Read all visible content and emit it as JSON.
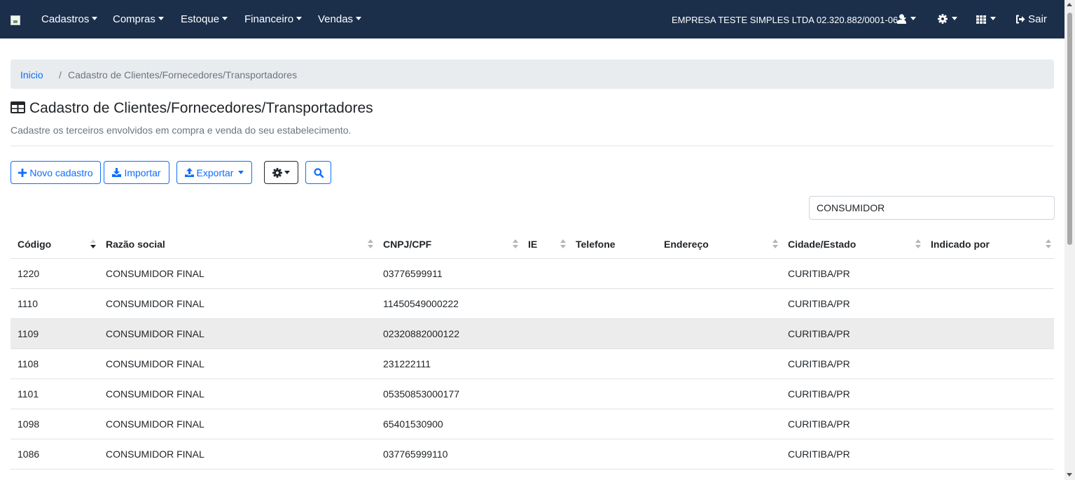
{
  "navbar": {
    "menus": [
      "Cadastros",
      "Compras",
      "Estoque",
      "Financeiro",
      "Vendas"
    ],
    "company": "EMPRESA TESTE SIMPLES LTDA 02.320.882/0001-06",
    "logout_label": "Sair",
    "icons": [
      "user-icon",
      "gear-icon",
      "apps-grid-icon",
      "sign-out-icon"
    ],
    "background": "#1b2f4b"
  },
  "breadcrumb": {
    "home": "Inicio",
    "separator": "/",
    "current": "Cadastro de Clientes/Fornecedores/Transportadores"
  },
  "page": {
    "title": "Cadastro de Clientes/Fornecedores/Transportadores",
    "subtitle": "Cadastre os terceiros envolvidos em compra e venda do seu estabelecimento."
  },
  "toolbar": {
    "new_label": "Novo cadastro",
    "import_label": "Importar",
    "export_label": "Exportar",
    "accent": "#0d6efd"
  },
  "search": {
    "value": "CONSUMIDOR"
  },
  "table": {
    "columns": [
      "Código",
      "Razão social",
      "CNPJ/CPF",
      "IE",
      "Telefone",
      "Endereço",
      "Cidade/Estado",
      "Indicado por"
    ],
    "rows": [
      [
        "1220",
        "CONSUMIDOR FINAL",
        "03776599911",
        "",
        "",
        "",
        "CURITIBA/PR",
        ""
      ],
      [
        "1110",
        "CONSUMIDOR FINAL",
        "11450549000222",
        "",
        "",
        "",
        "CURITIBA/PR",
        ""
      ],
      [
        "1109",
        "CONSUMIDOR FINAL",
        "02320882000122",
        "",
        "",
        "",
        "CURITIBA/PR",
        ""
      ],
      [
        "1108",
        "CONSUMIDOR FINAL",
        "231222111",
        "",
        "",
        "",
        "CURITIBA/PR",
        ""
      ],
      [
        "1101",
        "CONSUMIDOR FINAL",
        "05350853000177",
        "",
        "",
        "",
        "CURITIBA/PR",
        ""
      ],
      [
        "1098",
        "CONSUMIDOR FINAL",
        "65401530900",
        "",
        "",
        "",
        "CURITIBA/PR",
        ""
      ],
      [
        "1086",
        "CONSUMIDOR FINAL",
        "037765999110",
        "",
        "",
        "",
        "CURITIBA/PR",
        ""
      ]
    ]
  }
}
